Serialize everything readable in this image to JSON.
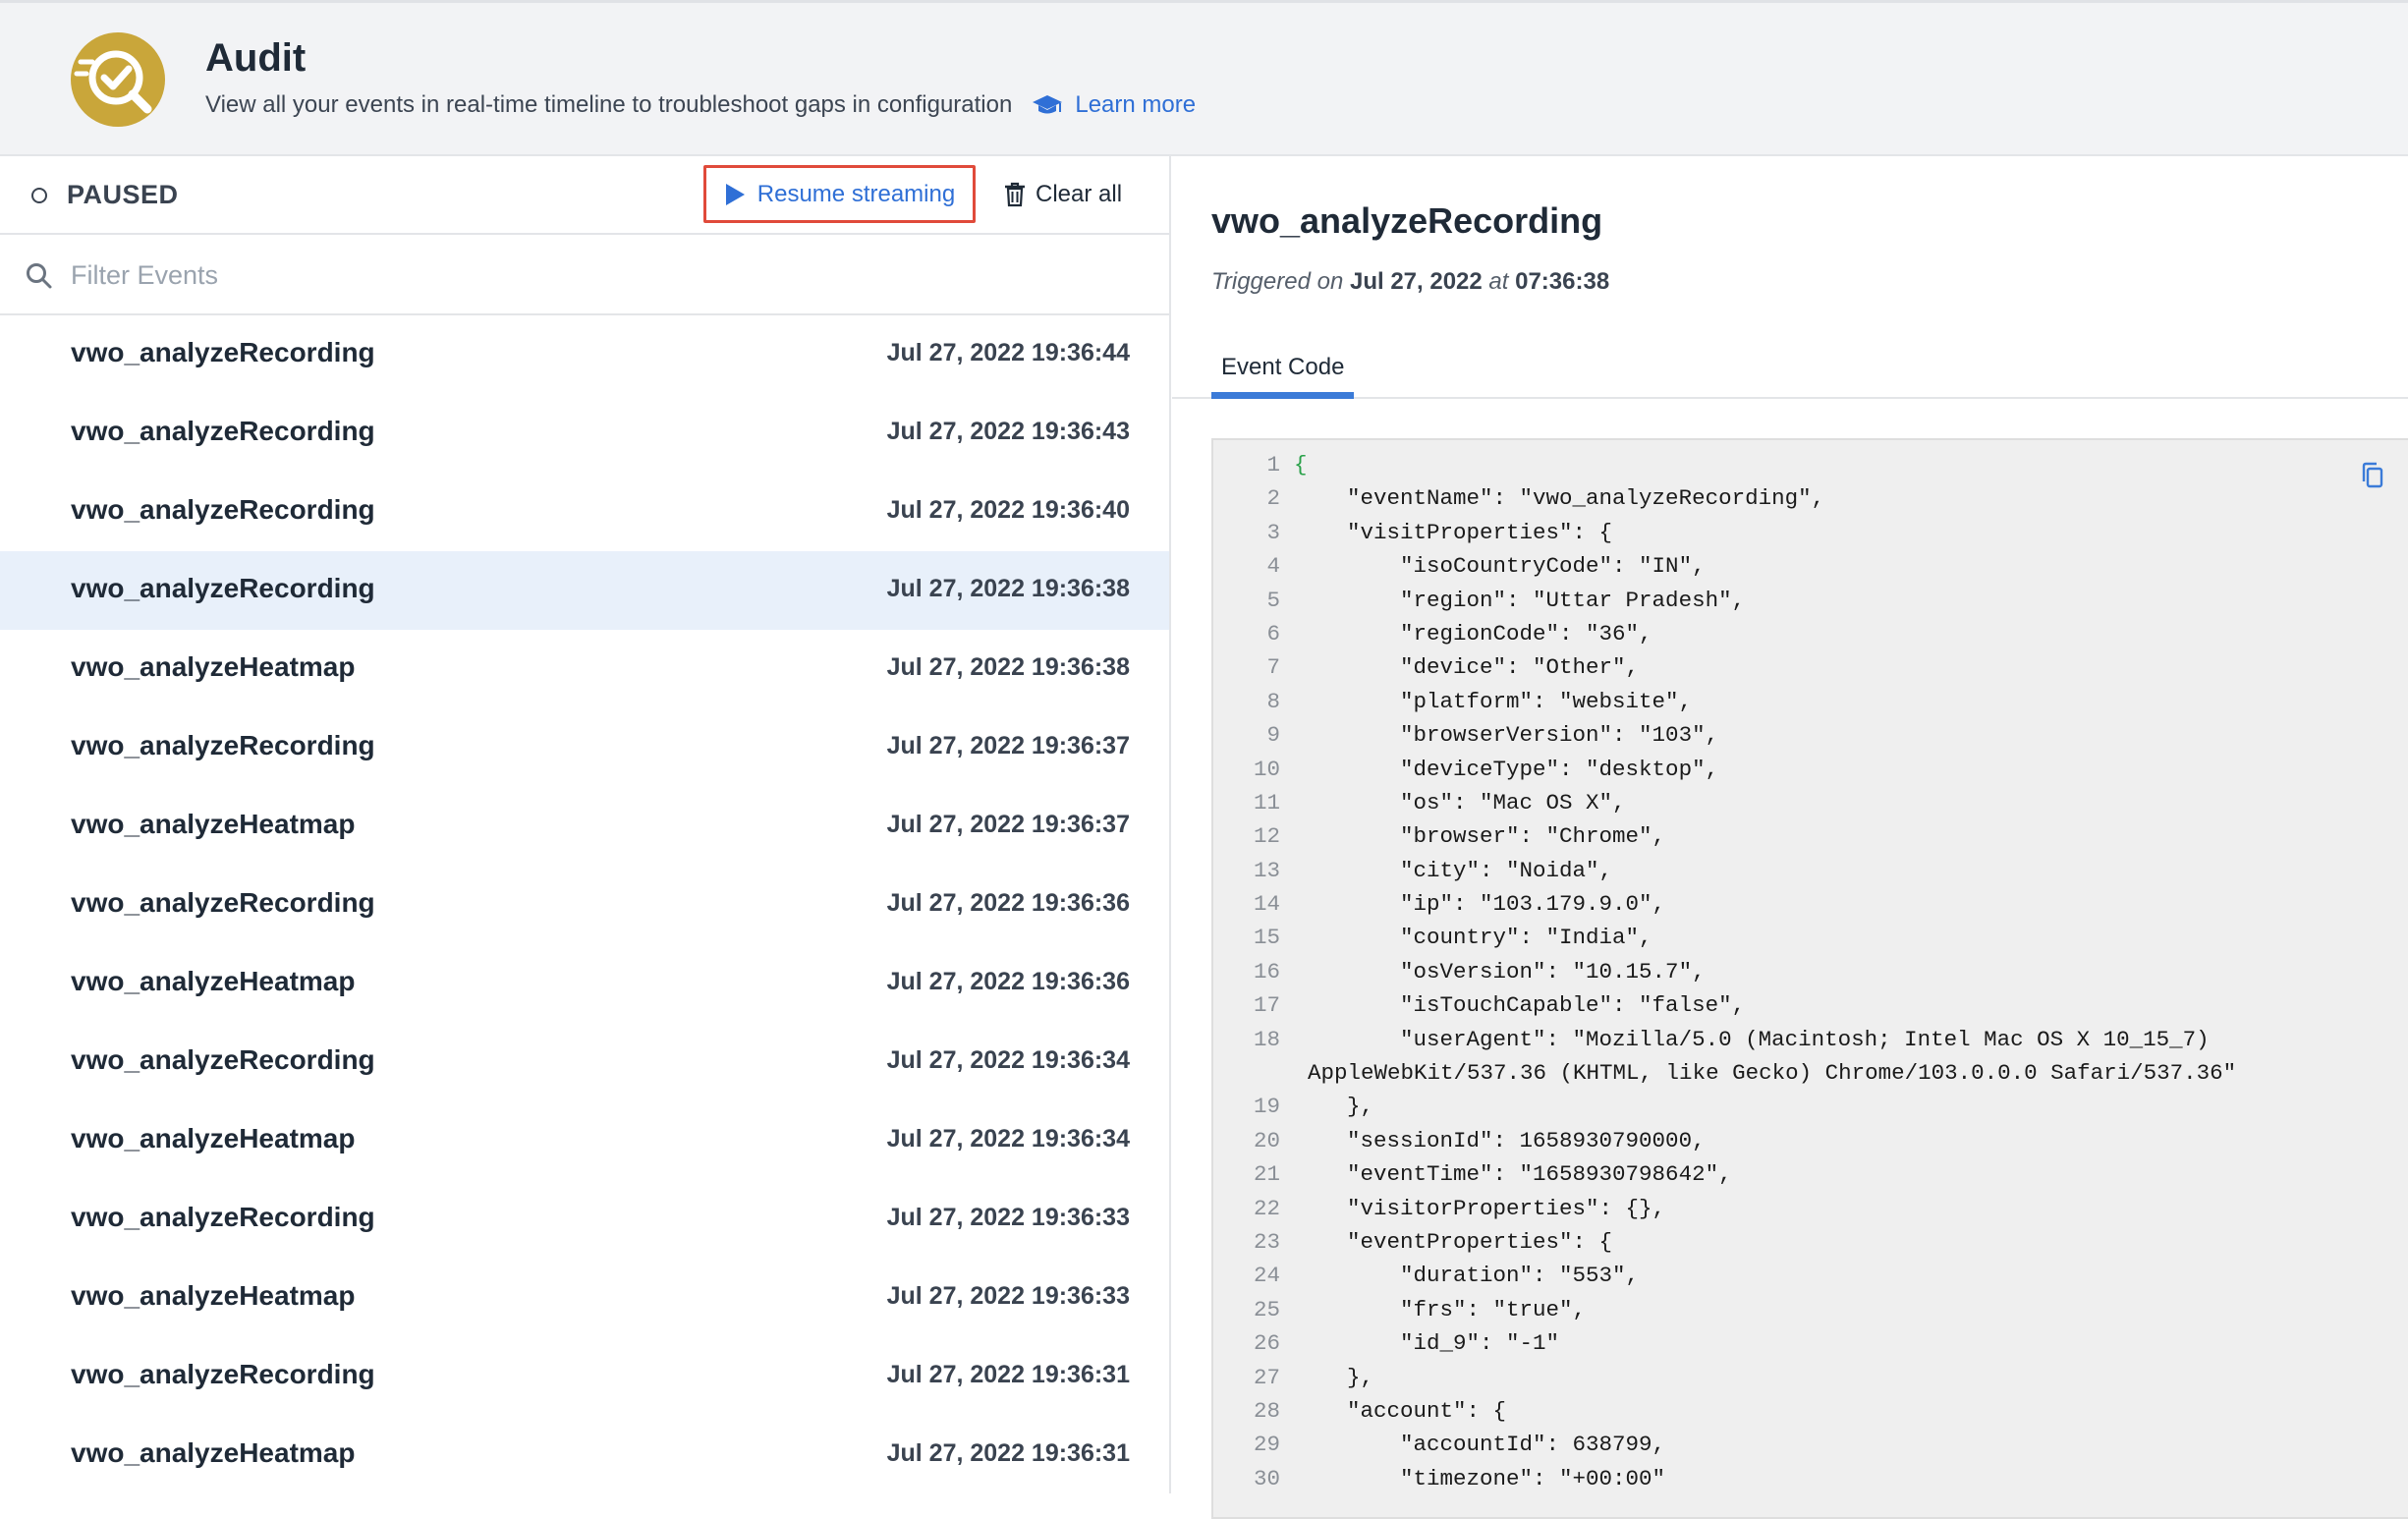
{
  "header": {
    "title": "Audit",
    "subtitle": "View all your events in real-time timeline to troubleshoot gaps in configuration",
    "learn_more": "Learn more"
  },
  "toolbar": {
    "status": "PAUSED",
    "resume_label": "Resume streaming",
    "clear_label": "Clear all"
  },
  "filter": {
    "placeholder": "Filter Events"
  },
  "events": [
    {
      "name": "vwo_analyzeRecording",
      "time": "Jul 27, 2022 19:36:44"
    },
    {
      "name": "vwo_analyzeRecording",
      "time": "Jul 27, 2022 19:36:43"
    },
    {
      "name": "vwo_analyzeRecording",
      "time": "Jul 27, 2022 19:36:40"
    },
    {
      "name": "vwo_analyzeRecording",
      "time": "Jul 27, 2022 19:36:38"
    },
    {
      "name": "vwo_analyzeHeatmap",
      "time": "Jul 27, 2022 19:36:38"
    },
    {
      "name": "vwo_analyzeRecording",
      "time": "Jul 27, 2022 19:36:37"
    },
    {
      "name": "vwo_analyzeHeatmap",
      "time": "Jul 27, 2022 19:36:37"
    },
    {
      "name": "vwo_analyzeRecording",
      "time": "Jul 27, 2022 19:36:36"
    },
    {
      "name": "vwo_analyzeHeatmap",
      "time": "Jul 27, 2022 19:36:36"
    },
    {
      "name": "vwo_analyzeRecording",
      "time": "Jul 27, 2022 19:36:34"
    },
    {
      "name": "vwo_analyzeHeatmap",
      "time": "Jul 27, 2022 19:36:34"
    },
    {
      "name": "vwo_analyzeRecording",
      "time": "Jul 27, 2022 19:36:33"
    },
    {
      "name": "vwo_analyzeHeatmap",
      "time": "Jul 27, 2022 19:36:33"
    },
    {
      "name": "vwo_analyzeRecording",
      "time": "Jul 27, 2022 19:36:31"
    },
    {
      "name": "vwo_analyzeHeatmap",
      "time": "Jul 27, 2022 19:36:31"
    }
  ],
  "selected_event_index": 3,
  "detail": {
    "title": "vwo_analyzeRecording",
    "triggered_prefix": "Triggered on",
    "triggered_date": "Jul 27, 2022",
    "triggered_at": "at",
    "triggered_time": "07:36:38",
    "tab_label": "Event Code"
  },
  "code_lines": [
    {
      "n": "1",
      "t": "{"
    },
    {
      "n": "2",
      "t": "    \"eventName\": \"vwo_analyzeRecording\","
    },
    {
      "n": "3",
      "t": "    \"visitProperties\": {"
    },
    {
      "n": "4",
      "t": "        \"isoCountryCode\": \"IN\","
    },
    {
      "n": "5",
      "t": "        \"region\": \"Uttar Pradesh\","
    },
    {
      "n": "6",
      "t": "        \"regionCode\": \"36\","
    },
    {
      "n": "7",
      "t": "        \"device\": \"Other\","
    },
    {
      "n": "8",
      "t": "        \"platform\": \"website\","
    },
    {
      "n": "9",
      "t": "        \"browserVersion\": \"103\","
    },
    {
      "n": "10",
      "t": "        \"deviceType\": \"desktop\","
    },
    {
      "n": "11",
      "t": "        \"os\": \"Mac OS X\","
    },
    {
      "n": "12",
      "t": "        \"browser\": \"Chrome\","
    },
    {
      "n": "13",
      "t": "        \"city\": \"Noida\","
    },
    {
      "n": "14",
      "t": "        \"ip\": \"103.179.9.0\","
    },
    {
      "n": "15",
      "t": "        \"country\": \"India\","
    },
    {
      "n": "16",
      "t": "        \"osVersion\": \"10.15.7\","
    },
    {
      "n": "17",
      "t": "        \"isTouchCapable\": \"false\","
    },
    {
      "n": "18",
      "t": "        \"userAgent\": \"Mozilla/5.0 (Macintosh; Intel Mac OS X 10_15_7)"
    },
    {
      "n": "",
      "t": "AppleWebKit/537.36 (KHTML, like Gecko) Chrome/103.0.0.0 Safari/537.36\""
    },
    {
      "n": "19",
      "t": "    },"
    },
    {
      "n": "20",
      "t": "    \"sessionId\": 1658930790000,"
    },
    {
      "n": "21",
      "t": "    \"eventTime\": \"1658930798642\","
    },
    {
      "n": "22",
      "t": "    \"visitorProperties\": {},"
    },
    {
      "n": "23",
      "t": "    \"eventProperties\": {"
    },
    {
      "n": "24",
      "t": "        \"duration\": \"553\","
    },
    {
      "n": "25",
      "t": "        \"frs\": \"true\","
    },
    {
      "n": "26",
      "t": "        \"id_9\": \"-1\""
    },
    {
      "n": "27",
      "t": "    },"
    },
    {
      "n": "28",
      "t": "    \"account\": {"
    },
    {
      "n": "29",
      "t": "        \"accountId\": 638799,"
    },
    {
      "n": "30",
      "t": "        \"timezone\": \"+00:00\""
    }
  ],
  "colors": {
    "accent": "#2f6fd6",
    "highlight_border": "#e04a3a",
    "selected_row": "#e8f0fa",
    "logo": "#c9a63a"
  }
}
